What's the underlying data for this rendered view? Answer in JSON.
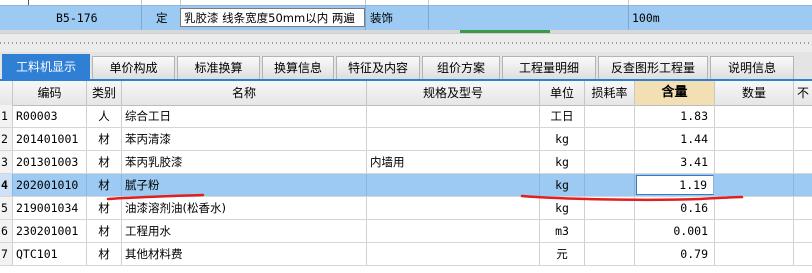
{
  "top_row": {
    "code": "B5-176",
    "type": "定",
    "name": "乳胶漆 线条宽度50mm以内 两遍",
    "category": "装饰",
    "unit": "100m"
  },
  "tabs": [
    {
      "label": "工料机显示",
      "active": true
    },
    {
      "label": "单价构成"
    },
    {
      "label": "标准换算"
    },
    {
      "label": "换算信息"
    },
    {
      "label": "特征及内容"
    },
    {
      "label": "组价方案"
    },
    {
      "label": "工程量明细"
    },
    {
      "label": "反查图形工程量"
    },
    {
      "label": "说明信息"
    }
  ],
  "columns": {
    "code": "编码",
    "type": "类别",
    "name": "名称",
    "spec": "规格及型号",
    "unit": "单位",
    "loss": "损耗率",
    "qty": "含量",
    "amount": "数量",
    "extra": "不"
  },
  "rows": [
    {
      "no": "1",
      "code": "R00003",
      "type": "人",
      "name": "综合工日",
      "spec": "",
      "unit": "工日",
      "loss": "",
      "qty": "1.83",
      "amount": ""
    },
    {
      "no": "2",
      "code": "201401001",
      "type": "材",
      "name": "苯丙清漆",
      "spec": "",
      "unit": "kg",
      "loss": "",
      "qty": "1.44",
      "amount": ""
    },
    {
      "no": "3",
      "code": "201301003",
      "type": "材",
      "name": "苯丙乳胶漆",
      "spec": "内墙用",
      "unit": "kg",
      "loss": "",
      "qty": "3.41",
      "amount": ""
    },
    {
      "no": "4",
      "code": "202001010",
      "type": "材",
      "name": "腻子粉",
      "spec": "",
      "unit": "kg",
      "loss": "",
      "qty": "1.19",
      "amount": "",
      "selected": true
    },
    {
      "no": "5",
      "code": "219001034",
      "type": "材",
      "name": "油漆溶剂油(松香水)",
      "spec": "",
      "unit": "kg",
      "loss": "",
      "qty": "0.16",
      "amount": ""
    },
    {
      "no": "6",
      "code": "230201001",
      "type": "材",
      "name": "工程用水",
      "spec": "",
      "unit": "m3",
      "loss": "",
      "qty": "0.001",
      "amount": ""
    },
    {
      "no": "7",
      "code": "QTC101",
      "type": "材",
      "name": "其他材料费",
      "spec": "",
      "unit": "元",
      "loss": "",
      "qty": "0.79",
      "amount": ""
    }
  ],
  "colors": {
    "accent": "#2f7fd4",
    "selected_row": "#9ccaf2",
    "annotation": "#e02020"
  }
}
